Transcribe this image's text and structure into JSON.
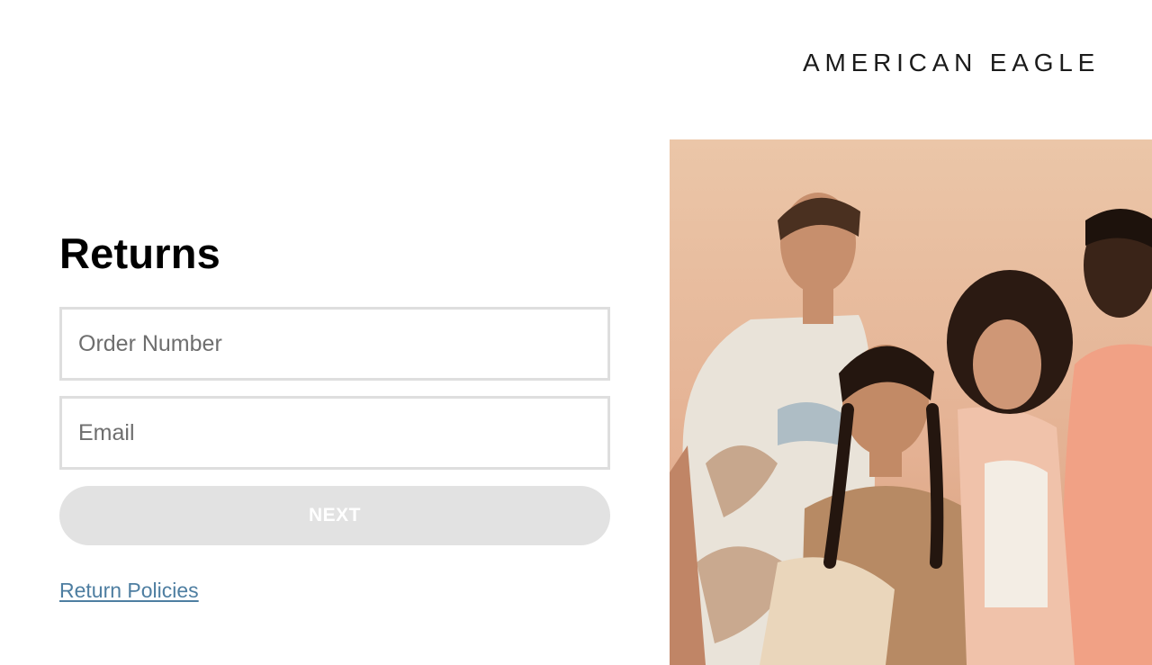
{
  "brand": {
    "name": "AMERICAN EAGLE"
  },
  "returns": {
    "title": "Returns",
    "order_number_placeholder": "Order Number",
    "email_placeholder": "Email",
    "next_label": "NEXT",
    "policy_link_label": "Return Policies"
  },
  "colors": {
    "button_disabled_bg": "#e2e2e2",
    "link": "#4e7ea1",
    "input_border": "#dedede"
  }
}
